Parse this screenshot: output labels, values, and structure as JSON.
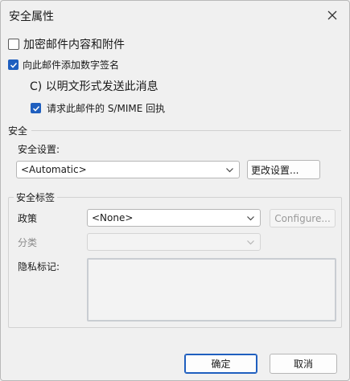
{
  "window": {
    "title": "安全属性"
  },
  "encrypt": {
    "label": "加密邮件内容和附件",
    "checked": false
  },
  "sign": {
    "label": "向此邮件添加数字签名",
    "checked": true
  },
  "clear_text": {
    "label": "C) 以明文形式发送此消息"
  },
  "smime_receipt": {
    "label": "请求此邮件的 S/MIME 回执",
    "checked": true
  },
  "security": {
    "section_label": "安全",
    "settings_label": "安全设置:",
    "settings_value": "<Automatic>",
    "change_button": "更改设置..."
  },
  "label_group": {
    "title": "安全标签",
    "policy_label": "政策",
    "policy_value": "<None>",
    "configure_button": "Configure...",
    "classification_label": "分类",
    "classification_value": "",
    "privacy_label": "隐私标记:"
  },
  "footer": {
    "ok_button": "确定",
    "cancel_button": "取消"
  },
  "colors": {
    "accent": "#1f5fbf",
    "background": "#f0f0f0"
  }
}
